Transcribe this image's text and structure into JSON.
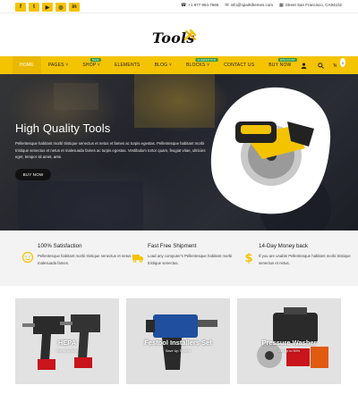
{
  "topbar": {
    "social_icons": [
      "facebook-icon",
      "twitter-icon",
      "youtube-icon",
      "instagram-icon",
      "linkedin-icon"
    ],
    "phone": "+1 877 904-7665",
    "email": "info@sparkthemes.com",
    "address": "Street San Francisco, CA94102"
  },
  "logo": {
    "text": "Tools"
  },
  "nav": {
    "items": [
      {
        "label": "HOME",
        "badge": ""
      },
      {
        "label": "PAGES",
        "badge": ""
      },
      {
        "label": "SHOP",
        "badge": "NEW"
      },
      {
        "label": "ELEMENTS",
        "badge": ""
      },
      {
        "label": "BLOG",
        "badge": ""
      },
      {
        "label": "BLOCKS",
        "badge": "ELEMENTOR"
      },
      {
        "label": "CONTACT US",
        "badge": ""
      },
      {
        "label": "BUY NOW",
        "badge": "DISCOUNT"
      }
    ],
    "cart_count": "0"
  },
  "hero": {
    "title": "High Quality Tools",
    "text": "Pellentesque habitant morbi tristique senectus et netus et fames ac turpis egestas. Pellentesque habitant morbi tristique senectus et netus et malesuada fames ac turpis egestas. Vestibulum tortor quam, feugiat vitae, ultricies eget, tempor sit amet, ante.",
    "button": "BUY NOW"
  },
  "features": [
    {
      "icon": "smiley-icon",
      "title": "100% Satisfaction",
      "text": "Pellentesque habitant morbi tristique senectus et netus et malesuada fames."
    },
    {
      "icon": "truck-icon",
      "title": "Fast Free Shipment",
      "text": "Load any computer's Pellentesque habitant morbi tristique senectus."
    },
    {
      "icon": "dollar-icon",
      "title": "14-Day Money back",
      "text": "If you are unable Pellentesque habitant morbi tristique senectus et netus."
    }
  ],
  "categories": [
    {
      "title": "HEPA",
      "sub": "Get up to 50%"
    },
    {
      "title": "Festool Installers Set",
      "sub": "Save Up To 50%"
    },
    {
      "title": "Pressure Washer",
      "sub": "Get up to 50%"
    }
  ],
  "colors": {
    "accent": "#f5c400",
    "dark": "#111111"
  }
}
